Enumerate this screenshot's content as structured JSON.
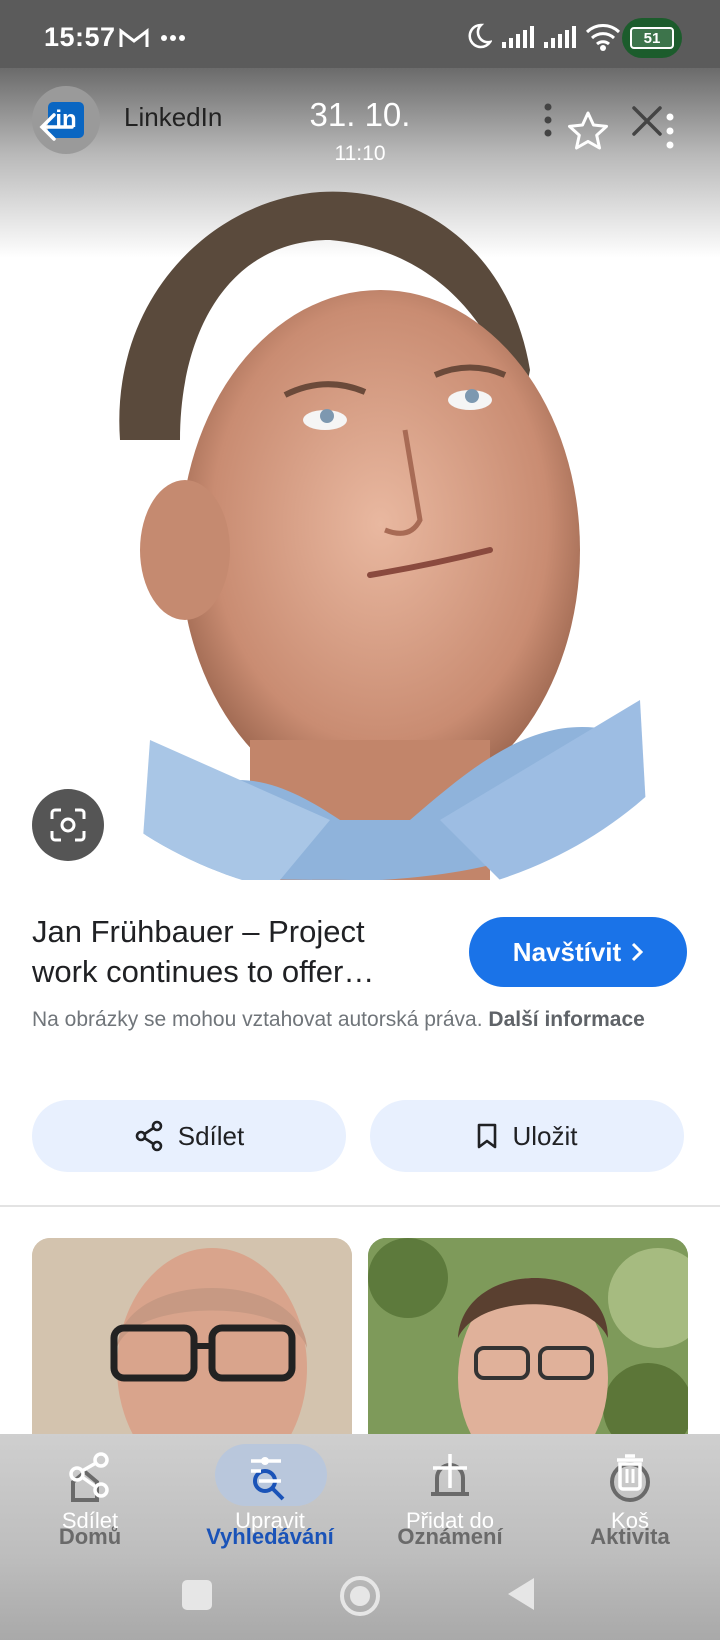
{
  "status_bar": {
    "time": "15:57",
    "battery": "51"
  },
  "header": {
    "source_name": "LinkedIn",
    "date": "31. 10.",
    "time": "11:10"
  },
  "result": {
    "title": "Jan Frühbauer – Project work continues to offer…",
    "visit_label": "Navštívit",
    "copyright_text": "Na obrázky se mohou vztahovat autorská práva.",
    "copyright_link": "Další informace",
    "share_label": "Sdílet",
    "save_label": "Uložit"
  },
  "bottom_nav": {
    "tabs": [
      {
        "label": "Domů",
        "overlay": "Sdílet",
        "icon": "share-icon"
      },
      {
        "label": "Vyhledávání",
        "overlay": "Upravit",
        "icon": "edit-icon"
      },
      {
        "label": "Oznámení",
        "overlay": "Přidat do",
        "icon": "add-icon"
      },
      {
        "label": "Aktivita",
        "overlay": "Koš",
        "icon": "trash-icon"
      }
    ]
  },
  "colors": {
    "accent": "#1a73e8",
    "pill": "#e8f0fe",
    "active_tab": "#1a53b8"
  }
}
